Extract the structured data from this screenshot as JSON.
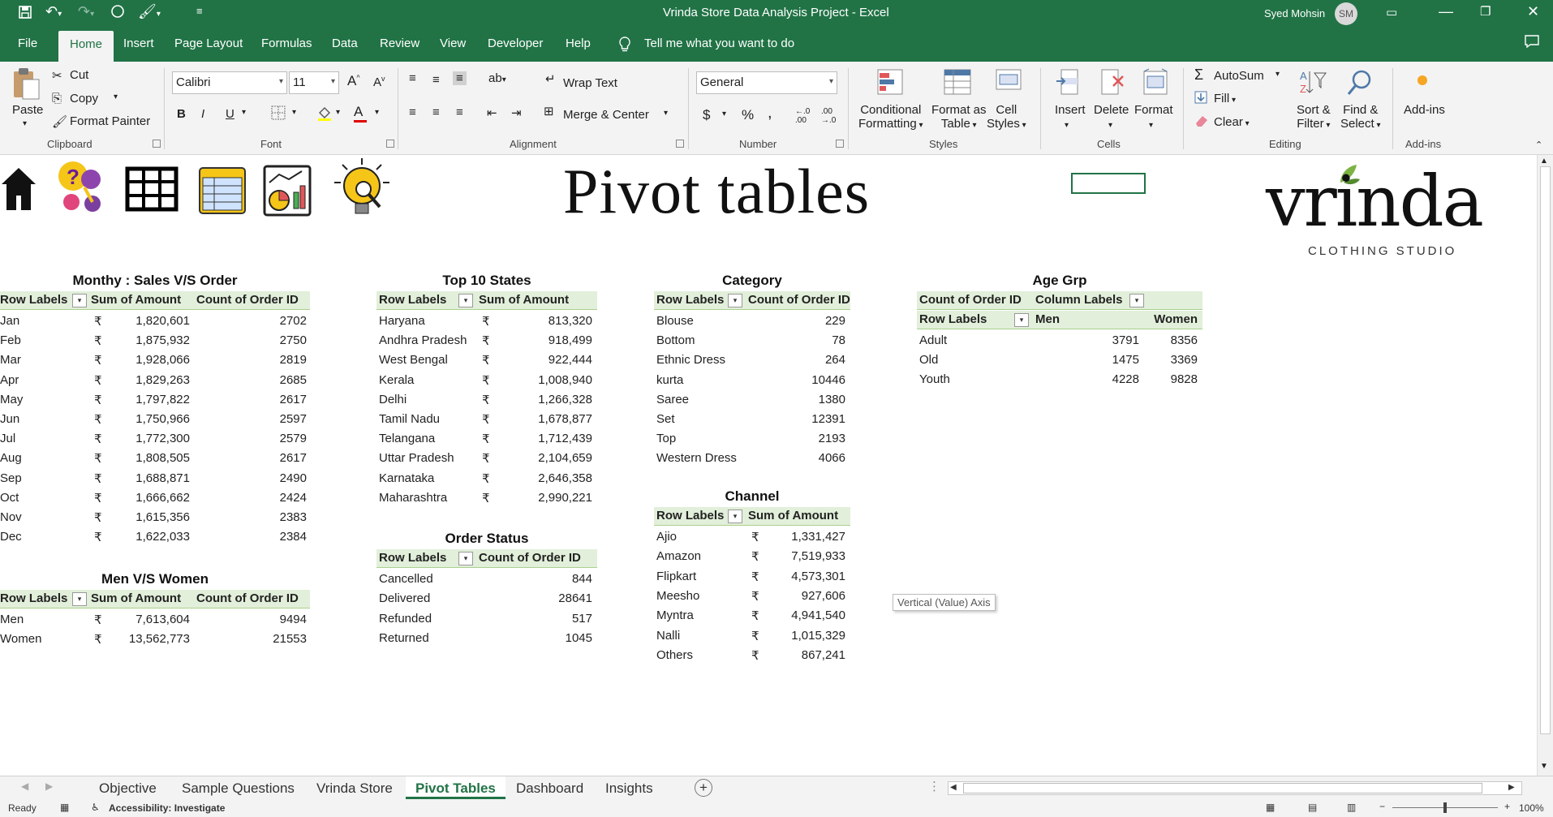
{
  "window": {
    "title": "Vrinda Store Data Analysis Project  -  Excel",
    "user": "Syed Mohsin",
    "avatar_initials": "SM"
  },
  "menu": {
    "tabs": [
      "File",
      "Home",
      "Insert",
      "Page Layout",
      "Formulas",
      "Data",
      "Review",
      "View",
      "Developer",
      "Help"
    ],
    "active": "Home",
    "tell_me": "Tell me what you want to do"
  },
  "ribbon": {
    "clipboard": {
      "paste": "Paste",
      "cut": "Cut",
      "copy": "Copy",
      "format_painter": "Format Painter",
      "label": "Clipboard"
    },
    "font": {
      "name": "Calibri",
      "size": "11",
      "label": "Font"
    },
    "alignment": {
      "wrap": "Wrap Text",
      "merge": "Merge & Center",
      "label": "Alignment"
    },
    "number": {
      "format": "General",
      "label": "Number",
      "currency": "$",
      "percent": "%",
      "comma": ","
    },
    "styles": {
      "conditional": "Conditional",
      "conditional2": "Formatting",
      "format_as": "Format as",
      "format_as2": "Table",
      "cell": "Cell",
      "cell2": "Styles",
      "label": "Styles"
    },
    "cells": {
      "insert": "Insert",
      "delete": "Delete",
      "format": "Format",
      "label": "Cells"
    },
    "editing": {
      "autosum": "AutoSum",
      "fill": "Fill",
      "clear": "Clear",
      "sort": "Sort &",
      "sort2": "Filter",
      "find": "Find &",
      "find2": "Select",
      "label": "Editing"
    },
    "addins": {
      "button": "Add-ins",
      "label": "Add-ins"
    }
  },
  "sheet": {
    "heading": "Pivot tables",
    "logo": {
      "name": "vrinda",
      "tagline": "CLOTHING STUDIO"
    },
    "tooltip": "Vertical (Value) Axis",
    "monthly": {
      "title": "Monthy : Sales V/S Order",
      "headers": [
        "Row Labels",
        "Sum of Amount",
        "Count of Order ID"
      ],
      "rows": [
        [
          "Jan",
          "₹",
          "1,820,601",
          "2702"
        ],
        [
          "Feb",
          "₹",
          "1,875,932",
          "2750"
        ],
        [
          "Mar",
          "₹",
          "1,928,066",
          "2819"
        ],
        [
          "Apr",
          "₹",
          "1,829,263",
          "2685"
        ],
        [
          "May",
          "₹",
          "1,797,822",
          "2617"
        ],
        [
          "Jun",
          "₹",
          "1,750,966",
          "2597"
        ],
        [
          "Jul",
          "₹",
          "1,772,300",
          "2579"
        ],
        [
          "Aug",
          "₹",
          "1,808,505",
          "2617"
        ],
        [
          "Sep",
          "₹",
          "1,688,871",
          "2490"
        ],
        [
          "Oct",
          "₹",
          "1,666,662",
          "2424"
        ],
        [
          "Nov",
          "₹",
          "1,615,356",
          "2383"
        ],
        [
          "Dec",
          "₹",
          "1,622,033",
          "2384"
        ]
      ]
    },
    "menwomen": {
      "title": "Men V/S Women",
      "headers": [
        "Row Labels",
        "Sum of Amount",
        "Count of Order ID"
      ],
      "rows": [
        [
          "Men",
          "₹",
          "7,613,604",
          "9494"
        ],
        [
          "Women",
          "₹",
          "13,562,773",
          "21553"
        ]
      ]
    },
    "states": {
      "title": "Top 10 States",
      "headers": [
        "Row Labels",
        "Sum of Amount"
      ],
      "rows": [
        [
          "Haryana",
          "₹",
          "813,320"
        ],
        [
          "Andhra Pradesh",
          "₹",
          "918,499"
        ],
        [
          "West Bengal",
          "₹",
          "922,444"
        ],
        [
          "Kerala",
          "₹",
          "1,008,940"
        ],
        [
          "Delhi",
          "₹",
          "1,266,328"
        ],
        [
          "Tamil Nadu",
          "₹",
          "1,678,877"
        ],
        [
          "Telangana",
          "₹",
          "1,712,439"
        ],
        [
          "Uttar Pradesh",
          "₹",
          "2,104,659"
        ],
        [
          "Karnataka",
          "₹",
          "2,646,358"
        ],
        [
          "Maharashtra",
          "₹",
          "2,990,221"
        ]
      ]
    },
    "status": {
      "title": "Order Status",
      "headers": [
        "Row Labels",
        "Count of Order ID"
      ],
      "rows": [
        [
          "Cancelled",
          "844"
        ],
        [
          "Delivered",
          "28641"
        ],
        [
          "Refunded",
          "517"
        ],
        [
          "Returned",
          "1045"
        ]
      ]
    },
    "category": {
      "title": "Category",
      "headers": [
        "Row Labels",
        "Count of Order ID"
      ],
      "rows": [
        [
          "Blouse",
          "229"
        ],
        [
          "Bottom",
          "78"
        ],
        [
          "Ethnic Dress",
          "264"
        ],
        [
          "kurta",
          "10446"
        ],
        [
          "Saree",
          "1380"
        ],
        [
          "Set",
          "12391"
        ],
        [
          "Top",
          "2193"
        ],
        [
          "Western Dress",
          "4066"
        ]
      ]
    },
    "channel": {
      "title": "Channel",
      "headers": [
        "Row Labels",
        "Sum of Amount"
      ],
      "rows": [
        [
          "Ajio",
          "₹",
          "1,331,427"
        ],
        [
          "Amazon",
          "₹",
          "7,519,933"
        ],
        [
          "Flipkart",
          "₹",
          "4,573,301"
        ],
        [
          "Meesho",
          "₹",
          "927,606"
        ],
        [
          "Myntra",
          "₹",
          "4,941,540"
        ],
        [
          "Nalli",
          "₹",
          "1,015,329"
        ],
        [
          "Others",
          "₹",
          "867,241"
        ]
      ]
    },
    "agegrp": {
      "title": "Age Grp",
      "header1": [
        "Count of Order ID",
        "Column Labels"
      ],
      "header2": [
        "Row Labels",
        "Men",
        "Women"
      ],
      "rows": [
        [
          "Adult",
          "3791",
          "8356"
        ],
        [
          "Old",
          "1475",
          "3369"
        ],
        [
          "Youth",
          "4228",
          "9828"
        ]
      ]
    }
  },
  "sheet_tabs": {
    "tabs": [
      "Objective",
      "Sample Questions",
      "Vrinda Store",
      "Pivot Tables",
      "Dashboard",
      "Insights"
    ],
    "active": "Pivot Tables"
  },
  "status": {
    "ready": "Ready",
    "accessibility": "Accessibility: Investigate",
    "zoom": "100%"
  }
}
